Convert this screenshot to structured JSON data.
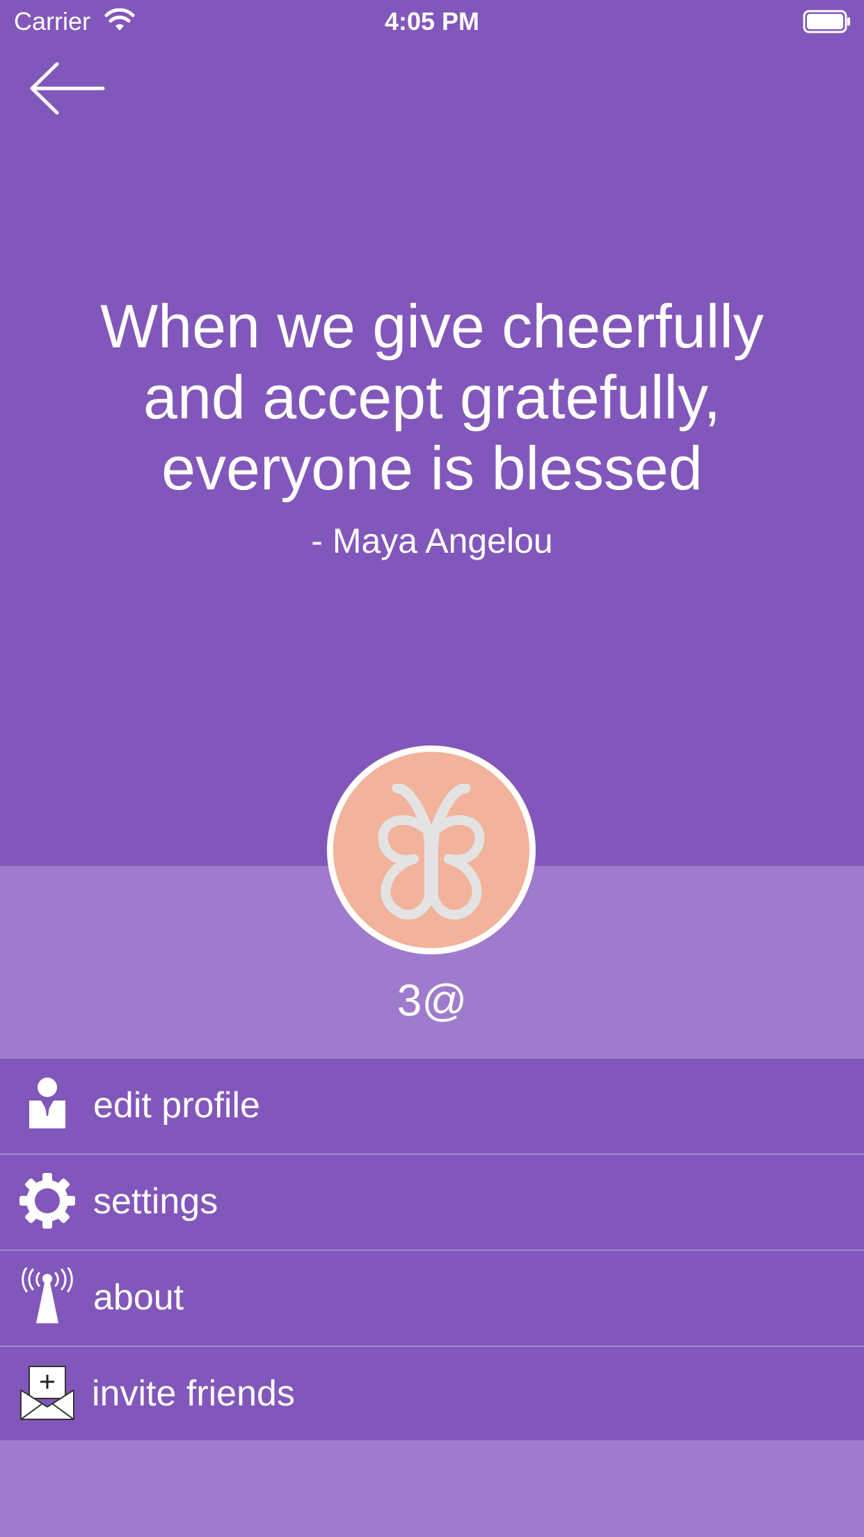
{
  "status_bar": {
    "carrier": "Carrier",
    "time": "4:05 PM"
  },
  "quote": {
    "text": "When we give cheerfully and accept gratefully, everyone is blessed",
    "author": "- Maya Angelou"
  },
  "profile": {
    "username": "3@",
    "avatar_icon": "butterfly-icon"
  },
  "menu": {
    "items": [
      {
        "label": "edit profile",
        "icon": "person-icon"
      },
      {
        "label": "settings",
        "icon": "gear-icon"
      },
      {
        "label": "about",
        "icon": "antenna-icon"
      },
      {
        "label": "invite friends",
        "icon": "envelope-plus-icon"
      }
    ]
  },
  "colors": {
    "background": "#8257BB",
    "band": "#9E7BCC",
    "avatar": "#F2B29B",
    "butterfly": "#E3E3E3",
    "divider": "#A587D1"
  }
}
